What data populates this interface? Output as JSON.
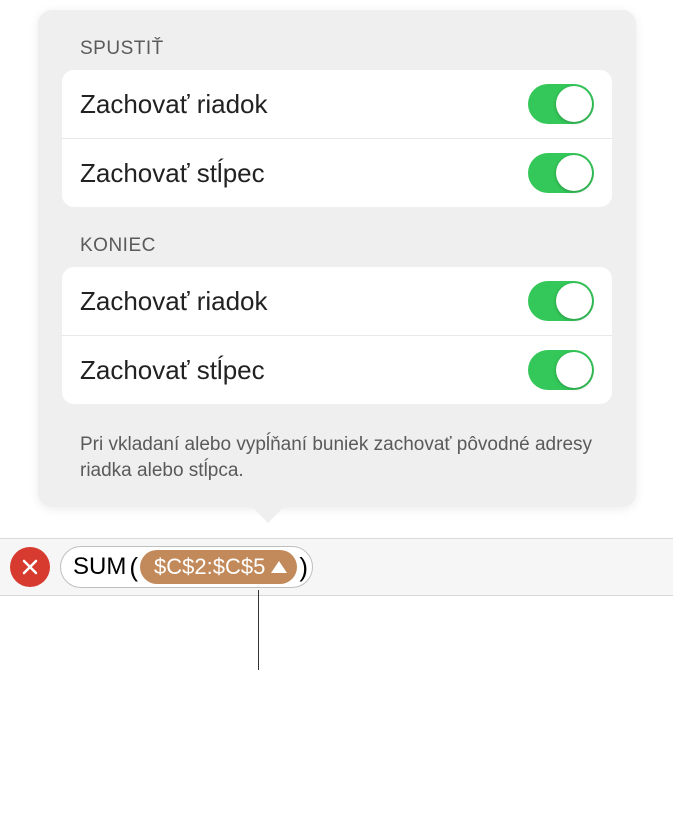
{
  "popover": {
    "section1": {
      "header": "SPUSTIŤ",
      "row1": {
        "label": "Zachovať riadok",
        "enabled": true
      },
      "row2": {
        "label": "Zachovať stĺpec",
        "enabled": true
      }
    },
    "section2": {
      "header": "KONIEC",
      "row1": {
        "label": "Zachovať riadok",
        "enabled": true
      },
      "row2": {
        "label": "Zachovať stĺpec",
        "enabled": true
      }
    },
    "footnote": "Pri vkladaní alebo vypĺňaní buniek zachovať pôvodné adresy riadka alebo stĺpca."
  },
  "formula": {
    "function": "SUM",
    "range": "$C$2:$C$5"
  }
}
